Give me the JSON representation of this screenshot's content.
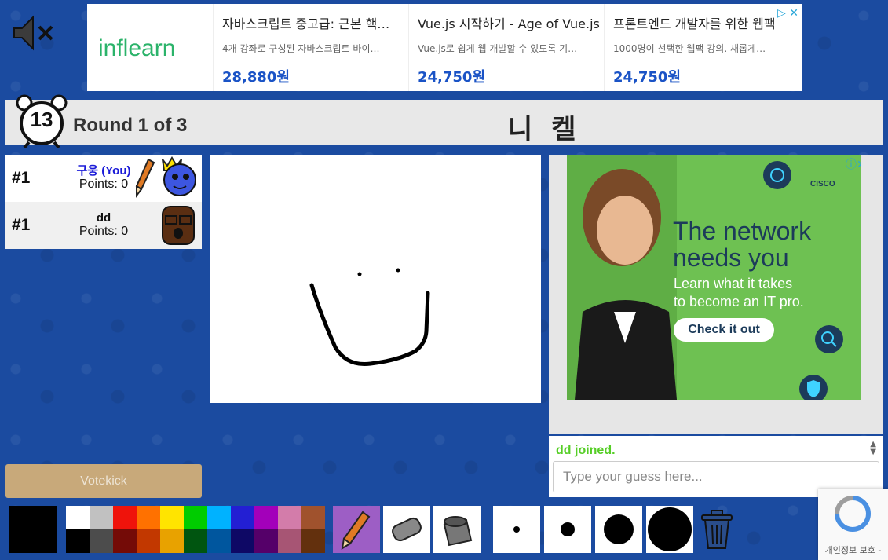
{
  "ad_top": {
    "logo": "inflearn",
    "items": [
      {
        "title": "자바스크립트 중고급: 근본 핵…",
        "desc": "4개 강좌로 구성된 자바스크립트 바이…",
        "price": "28,880원"
      },
      {
        "title": "Vue.js 시작하기 - Age of Vue.js",
        "desc": "Vue.js로 쉽게 웹 개발할 수 있도록 기…",
        "price": "24,750원"
      },
      {
        "title": "프론트엔드 개발자를 위한 웹팩",
        "desc": "1000명이 선택한 웹팩 강의. 새롭게…",
        "price": "24,750원"
      }
    ],
    "close": "✕"
  },
  "header": {
    "timer": "13",
    "round": "Round 1 of 3",
    "word": "니 켈"
  },
  "players": [
    {
      "rank": "#1",
      "name": "구웅 (You)",
      "points": "Points: 0",
      "is_you": true,
      "drawing": true,
      "name_color": "#1a1ad8"
    },
    {
      "rank": "#1",
      "name": "dd",
      "points": "Points: 0",
      "is_you": false,
      "drawing": false,
      "name_color": "#111111"
    }
  ],
  "side_ad": {
    "headline_1": "The network",
    "headline_2": "needs you",
    "sub_1": "Learn what it takes",
    "sub_2": "to become an IT pro.",
    "button": "Check it out",
    "brand": "CISCO"
  },
  "chat": {
    "messages": [
      {
        "text": "dd joined.",
        "color": "#56ce27"
      }
    ],
    "input_placeholder": "Type your guess here..."
  },
  "votekick": "Votekick",
  "toolbar": {
    "current_color": "#000000",
    "palette": [
      "#ffffff",
      "#c1c1c1",
      "#ef130b",
      "#ff7100",
      "#ffe400",
      "#00cc00",
      "#00b2ff",
      "#231fd3",
      "#a300ba",
      "#d37caa",
      "#a0522d",
      "#000000",
      "#4c4c4c",
      "#740b07",
      "#c23800",
      "#e8a200",
      "#005510",
      "#00569e",
      "#0e0865",
      "#550069",
      "#a75574",
      "#63300d"
    ],
    "tools": [
      "pencil-tool",
      "eraser-tool",
      "fill-tool"
    ],
    "brush_sizes": [
      "small",
      "medium",
      "large",
      "xlarge"
    ]
  },
  "recaptcha": "개인정보 보호 -"
}
